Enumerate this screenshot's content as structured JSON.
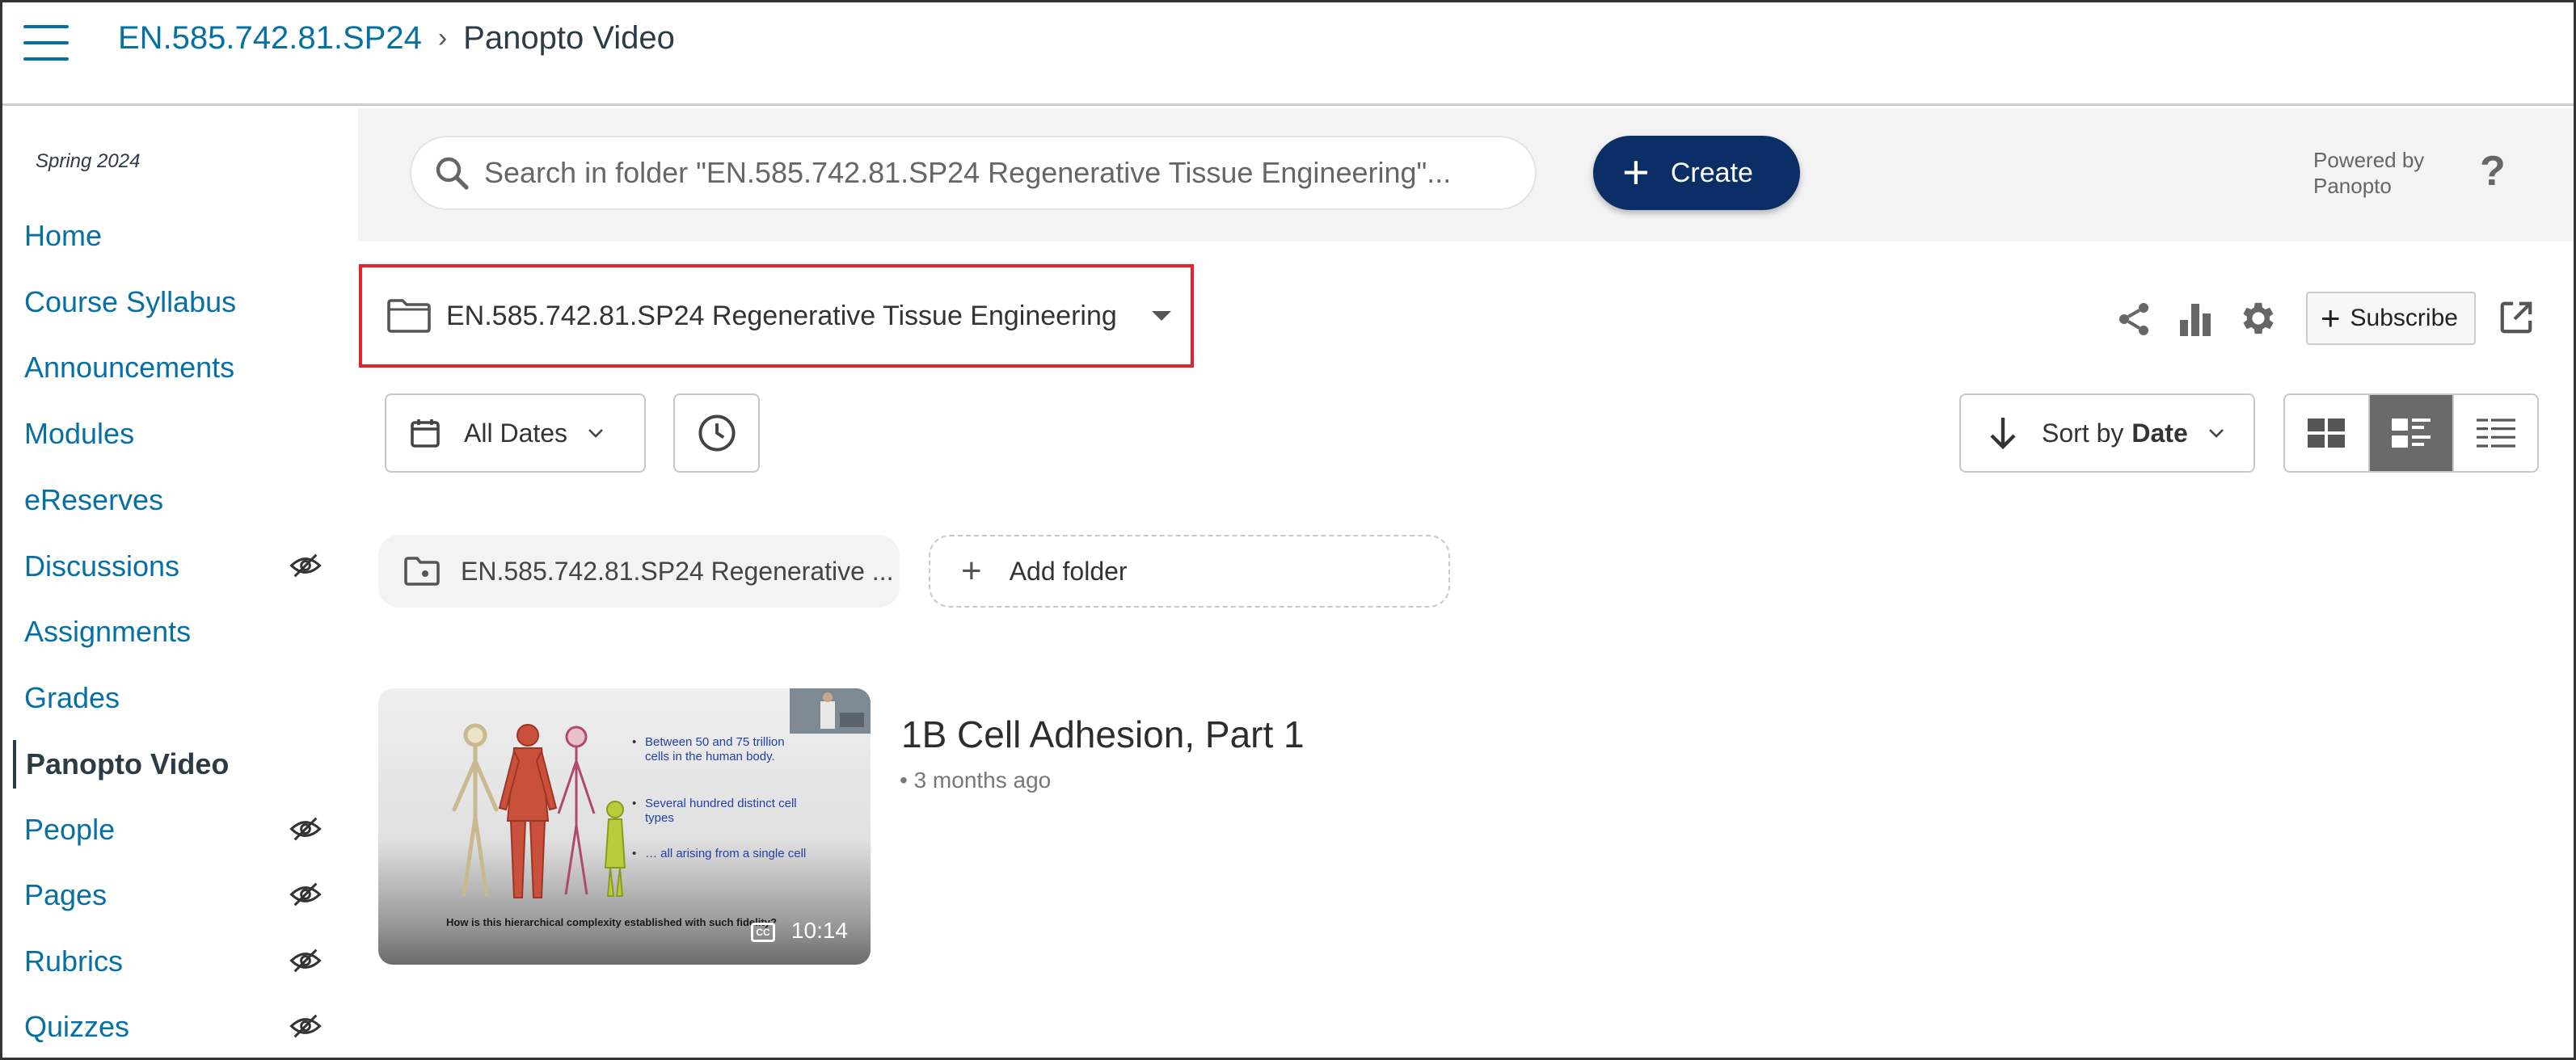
{
  "header": {
    "course_link": "EN.585.742.81.SP24",
    "separator": "›",
    "current_page": "Panopto Video"
  },
  "nav": {
    "term": "Spring 2024",
    "items": [
      {
        "label": "Home",
        "hidden": false,
        "active": false
      },
      {
        "label": "Course Syllabus",
        "hidden": false,
        "active": false
      },
      {
        "label": "Announcements",
        "hidden": false,
        "active": false
      },
      {
        "label": "Modules",
        "hidden": false,
        "active": false
      },
      {
        "label": "eReserves",
        "hidden": false,
        "active": false
      },
      {
        "label": "Discussions",
        "hidden": true,
        "active": false
      },
      {
        "label": "Assignments",
        "hidden": false,
        "active": false
      },
      {
        "label": "Grades",
        "hidden": false,
        "active": false
      },
      {
        "label": "Panopto Video",
        "hidden": false,
        "active": true
      },
      {
        "label": "People",
        "hidden": true,
        "active": false
      },
      {
        "label": "Pages",
        "hidden": true,
        "active": false
      },
      {
        "label": "Rubrics",
        "hidden": true,
        "active": false
      },
      {
        "label": "Quizzes",
        "hidden": true,
        "active": false
      }
    ]
  },
  "panopto": {
    "search_placeholder": "Search in folder \"EN.585.742.81.SP24 Regenerative Tissue Engineering\"...",
    "create_label": "Create",
    "powered_by": "Powered by Panopto",
    "help": "?",
    "folder_title": "EN.585.742.81.SP24 Regenerative Tissue Engineering",
    "subscribe_label": "Subscribe",
    "date_filter": "All Dates",
    "sort_prefix": "Sort by",
    "sort_field": "Date",
    "subfolder_name": "EN.585.742.81.SP24 Regenerative ...",
    "add_folder_label": "Add folder"
  },
  "video": {
    "title": "1B Cell Adhesion, Part 1",
    "age": "• 3 months ago",
    "duration": "10:14",
    "cc": "CC",
    "slide_bullets": [
      "Between 50 and 75 trillion cells in the human body.",
      "Several hundred distinct cell types",
      "… all arising from a single cell"
    ],
    "slide_caption": "How is this hierarchical complexity established with such fidelity?"
  },
  "colors": {
    "link": "#0770a3",
    "create_bg": "#0b2e66",
    "highlight_border": "#e5212d"
  }
}
